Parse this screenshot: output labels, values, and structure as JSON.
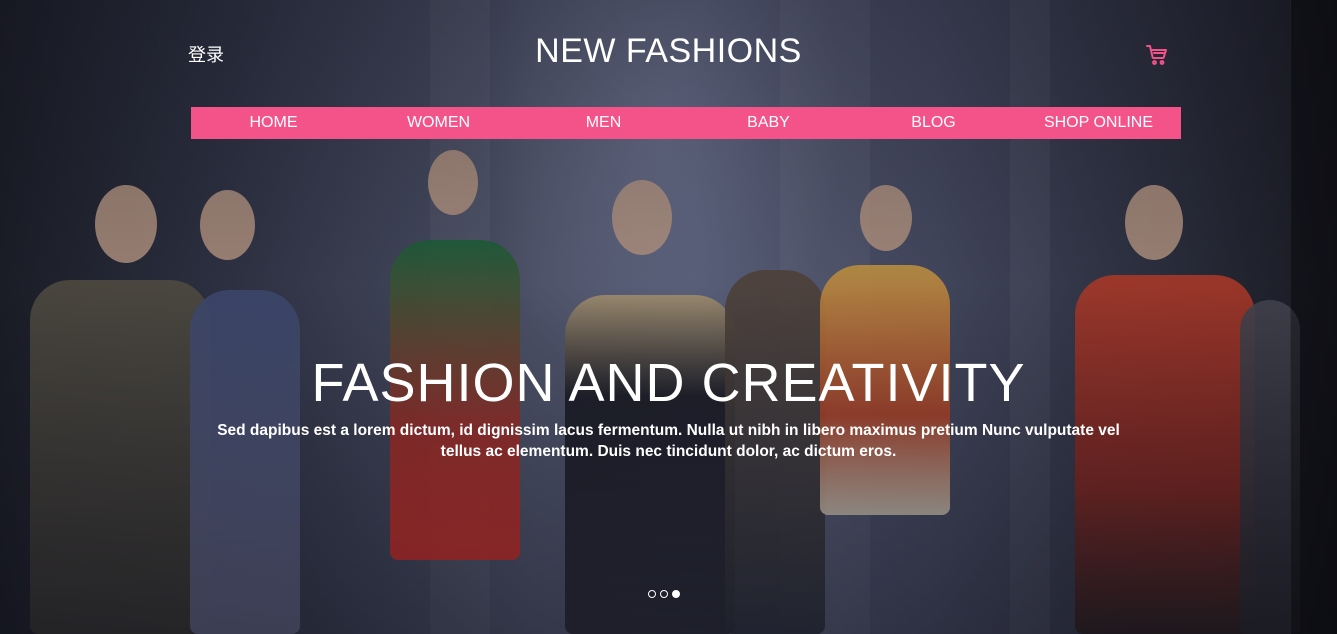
{
  "header": {
    "login_label": "登录",
    "brand": "NEW FASHIONS",
    "cart_icon": "shopping-cart-icon"
  },
  "nav": {
    "items": [
      {
        "label": "HOME"
      },
      {
        "label": "WOMEN"
      },
      {
        "label": "MEN"
      },
      {
        "label": "BABY"
      },
      {
        "label": "BLOG"
      },
      {
        "label": "SHOP ONLINE"
      }
    ]
  },
  "hero": {
    "headline": "FASHION AND CREATIVITY",
    "subtext": "Sed dapibus est a lorem dictum, id dignissim lacus fermentum. Nulla ut nibh in libero maximus pretium Nunc vulputate vel tellus ac elementum. Duis nec tincidunt dolor, ac dictum eros.",
    "slides_total": 3,
    "active_slide": 3
  },
  "colors": {
    "accent": "#f4538a",
    "text": "#ffffff"
  }
}
